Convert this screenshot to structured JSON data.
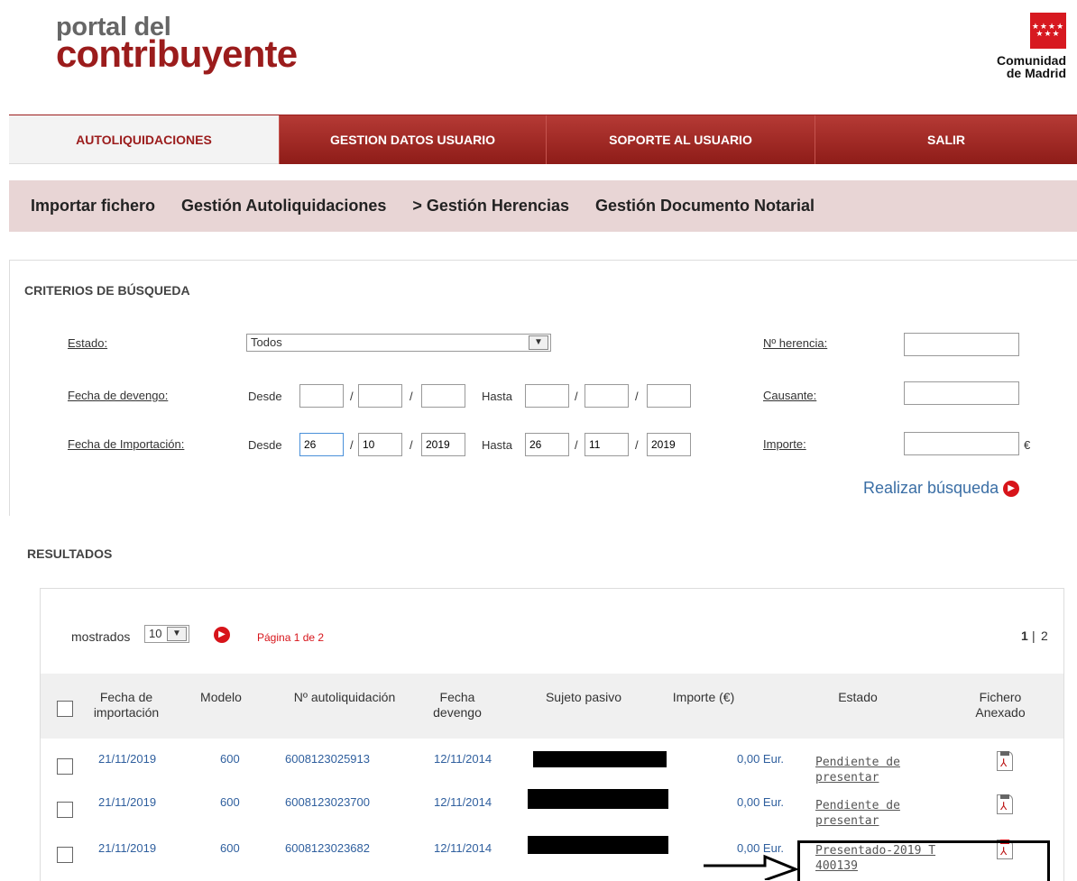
{
  "header": {
    "logo_small": "portal del",
    "logo_big": "contribuyente",
    "region_line1": "Comunidad",
    "region_line2": "de Madrid"
  },
  "topnav": [
    {
      "label": "AUTOLIQUIDACIONES",
      "active": true
    },
    {
      "label": "GESTION DATOS USUARIO",
      "active": false
    },
    {
      "label": "SOPORTE AL USUARIO",
      "active": false
    },
    {
      "label": "SALIR",
      "active": false
    }
  ],
  "subnav": [
    "Importar fichero",
    "Gestión Autoliquidaciones",
    "> Gestión Herencias",
    "Gestión Documento Notarial"
  ],
  "criteria": {
    "title": "CRITERIOS DE BÚSQUEDA",
    "estado_label": "Estado:",
    "estado_value": "Todos",
    "fecha_devengo_label": "Fecha de devengo:",
    "fecha_importacion_label": "Fecha de Importación:",
    "desde": "Desde",
    "hasta": "Hasta",
    "slash": "/",
    "importacion_desde": {
      "d": "26",
      "m": "10",
      "y": "2019"
    },
    "importacion_hasta": {
      "d": "26",
      "m": "11",
      "y": "2019"
    },
    "herencia_label": "Nº herencia:",
    "causante_label": "Causante:",
    "importe_label": "Importe:",
    "currency": "€",
    "search_label": "Realizar búsqueda"
  },
  "results": {
    "title": "RESULTADOS",
    "mostrados_label": "mostrados",
    "page_size": "10",
    "page_info": "Página  1  de 2",
    "pages_current": "1",
    "pages_sep": "|",
    "pages_next": "2",
    "columns": [
      "Fecha de importación",
      "Modelo",
      "Nº autoliquidación",
      "Fecha devengo",
      "Sujeto pasivo",
      "Importe (€)",
      "Estado",
      "Fichero Anexado"
    ],
    "rows": [
      {
        "fecha": "21/11/2019",
        "modelo": "600",
        "num": "6008123025913",
        "devengo": "12/11/2014",
        "importe": "0,00 Eur.",
        "estado_l1": "Pendiente de",
        "estado_l2": "presentar"
      },
      {
        "fecha": "21/11/2019",
        "modelo": "600",
        "num": "6008123023700",
        "devengo": "12/11/2014",
        "importe": "0,00 Eur.",
        "estado_l1": "Pendiente de",
        "estado_l2": "presentar"
      },
      {
        "fecha": "21/11/2019",
        "modelo": "600",
        "num": "6008123023682",
        "devengo": "12/11/2014",
        "importe": "0,00 Eur.",
        "estado_l1": "Presentado-2019 T",
        "estado_l2": "400139"
      }
    ]
  }
}
